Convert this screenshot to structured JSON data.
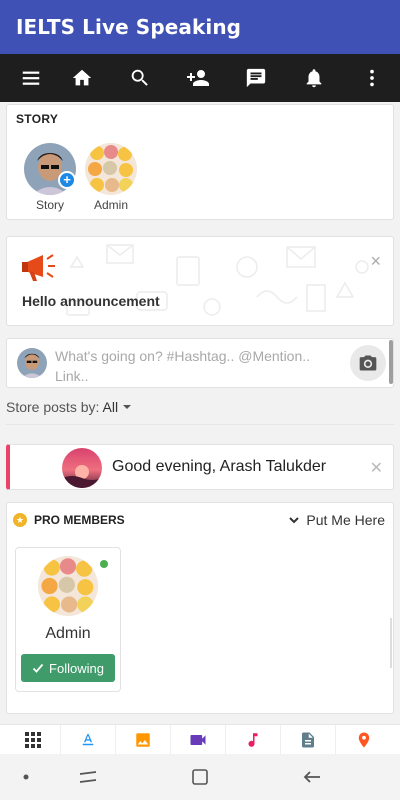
{
  "app": {
    "title": "IELTS Live Speaking"
  },
  "navbar": {
    "icons": [
      "menu-icon",
      "home-icon",
      "search-icon",
      "add-person-icon",
      "chat-icon",
      "bell-icon",
      "more-vert-icon"
    ]
  },
  "story": {
    "heading": "STORY",
    "items": [
      {
        "label": "Story"
      },
      {
        "label": "Admin"
      }
    ]
  },
  "announcement": {
    "text": "Hello announcement",
    "close": "×"
  },
  "composer": {
    "placeholder": "What's going on? #Hashtag.. @Mention.. Link.."
  },
  "sort": {
    "label": "Store posts by:",
    "value": "All"
  },
  "greeting": {
    "text": "Good evening, Arash Talukder",
    "close": "✕"
  },
  "pro_members": {
    "title": "PRO MEMBERS",
    "action": "Put Me Here",
    "members": [
      {
        "name": "Admin",
        "button": "Following",
        "online": true
      }
    ]
  },
  "tabbar": {
    "icons": [
      "apps-grid-icon",
      "text-format-icon",
      "image-icon",
      "video-icon",
      "music-icon",
      "file-icon",
      "location-icon"
    ],
    "colors": {
      "apps": "#333333",
      "text": "#2196f3",
      "image": "#ff9800",
      "video": "#673ab7",
      "music": "#e91e63",
      "file": "#607d8b",
      "location": "#ff5722"
    }
  },
  "system_nav": {
    "icons": [
      "dot-icon",
      "recent-apps-icon",
      "home-square-icon",
      "back-icon"
    ]
  },
  "colors": {
    "primary": "#3f51b5",
    "nav": "#1e1e1e",
    "following": "#3f9b6a",
    "greeting_accent": "#e8416a"
  }
}
